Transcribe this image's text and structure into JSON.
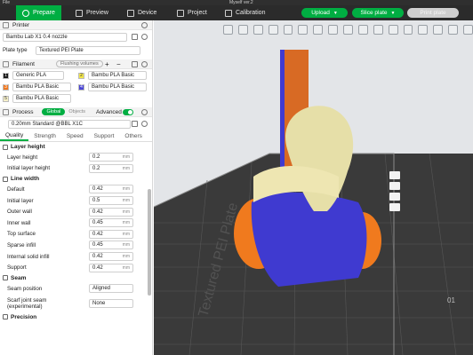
{
  "titlebar": {
    "file_label": "File",
    "window_title": "Myself ver.2"
  },
  "topbar": {
    "tabs": [
      {
        "label": "Prepare"
      },
      {
        "label": "Preview"
      },
      {
        "label": "Device"
      },
      {
        "label": "Project"
      },
      {
        "label": "Calibration"
      }
    ],
    "upload_label": "Upload",
    "slice_label": "Slice plate",
    "print_label": "Print plate"
  },
  "printer": {
    "heading": "Printer",
    "model": "Bambu Lab X1 0.4 nozzle",
    "plate_type_label": "Plate type",
    "plate_type_value": "Textured PEI Plate"
  },
  "filament": {
    "heading": "Filament",
    "flushing_label": "Flushing volumes",
    "items": [
      {
        "num": "1",
        "name": "Generic PLA",
        "color": "#1a1a1a"
      },
      {
        "num": "2",
        "name": "Bambu PLA Basic",
        "color": "#f2e64a"
      },
      {
        "num": "3",
        "name": "Bambu PLA Basic",
        "color": "#f07820"
      },
      {
        "num": "4",
        "name": "Bambu PLA Basic",
        "color": "#4a44d6"
      },
      {
        "num": "5",
        "name": "Bambu PLA Basic",
        "color": "#f6f0c8"
      }
    ]
  },
  "process": {
    "heading": "Process",
    "global_label": "Global",
    "objects_label": "Objects",
    "advanced_label": "Advanced",
    "preset": "0.20mm Standard @BBL X1C",
    "tabs": [
      "Quality",
      "Strength",
      "Speed",
      "Support",
      "Others"
    ],
    "groups": [
      {
        "title": "Layer height",
        "params": [
          {
            "label": "Layer height",
            "value": "0.2",
            "unit": "mm"
          },
          {
            "label": "Initial layer height",
            "value": "0.2",
            "unit": "mm"
          }
        ]
      },
      {
        "title": "Line width",
        "params": [
          {
            "label": "Default",
            "value": "0.42",
            "unit": "mm"
          },
          {
            "label": "Initial layer",
            "value": "0.5",
            "unit": "mm"
          },
          {
            "label": "Outer wall",
            "value": "0.42",
            "unit": "mm"
          },
          {
            "label": "Inner wall",
            "value": "0.45",
            "unit": "mm"
          },
          {
            "label": "Top surface",
            "value": "0.42",
            "unit": "mm"
          },
          {
            "label": "Sparse infill",
            "value": "0.45",
            "unit": "mm"
          },
          {
            "label": "Internal solid infill",
            "value": "0.42",
            "unit": "mm"
          },
          {
            "label": "Support",
            "value": "0.42",
            "unit": "mm"
          }
        ]
      },
      {
        "title": "Seam",
        "params": [
          {
            "label": "Seam position",
            "value": "Aligned"
          },
          {
            "label": "Scarf joint seam (experimental)",
            "value": "None"
          }
        ]
      },
      {
        "title": "Precision",
        "params": []
      }
    ]
  },
  "viewport": {
    "plate_text": "Textured PEI Plate",
    "plate_number": "01",
    "colors": {
      "bed": "#3a3a3a",
      "grid": "#5a5a5a",
      "model_skin": "#e6dfa8",
      "model_blue": "#3f3ad0",
      "model_orange": "#f07a1e",
      "tower_orange": "#d86a24"
    }
  }
}
